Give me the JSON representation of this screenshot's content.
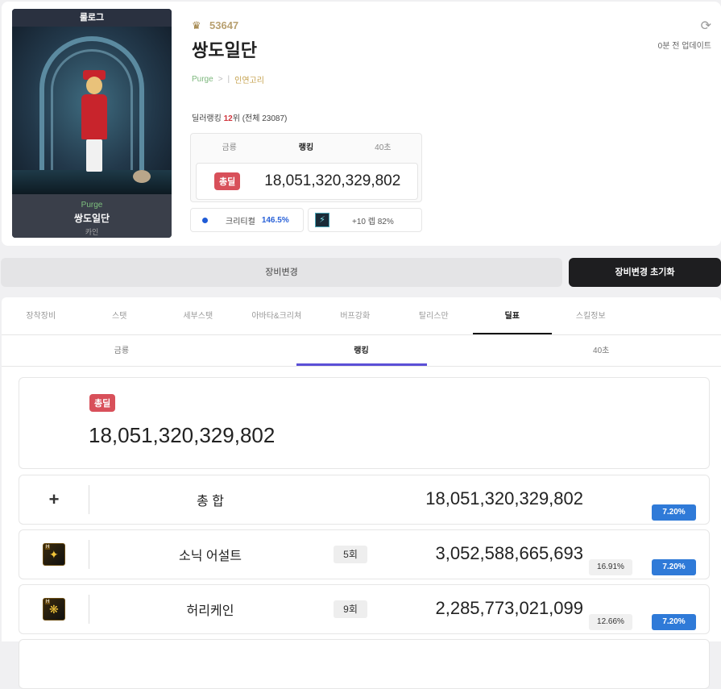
{
  "character": {
    "panel_header": "룰로그",
    "class_label": "Purge",
    "name": "쌍도일단",
    "sub": "카인",
    "fame": "53647",
    "title": "쌍도일단",
    "class_tag": "Purge",
    "class_tag_arrow": ">",
    "guild_tag": "인연고리",
    "rank_prefix": "딜러랭킹",
    "rank_num": "12",
    "rank_suffix": "위 (전체 23087)",
    "update_text": "0분 전 업데이트"
  },
  "mini": {
    "tabs": [
      "금룡",
      "랭킹",
      "40초"
    ],
    "active_tab": 1,
    "badge": "총딜",
    "value": "18,051,320,329,802",
    "crit_label": "크리티컬",
    "crit_value": "146.5%",
    "enh_label": "+10 렙 82%"
  },
  "buttons": {
    "change": "장비변경",
    "reset": "장비변경 초기화"
  },
  "tabs": [
    "장착장비",
    "스탯",
    "세부스탯",
    "아바타&크리쳐",
    "버프강화",
    "탈리스만",
    "딜표",
    "스킬정보"
  ],
  "active_tab": 6,
  "subtabs": [
    "금룡",
    "랭킹",
    "40초"
  ],
  "active_subtab": 1,
  "total": {
    "badge": "총딜",
    "value": "18,051,320,329,802"
  },
  "rows": [
    {
      "name": "총 합",
      "count": "",
      "value": "18,051,320,329,802",
      "pct_share": "",
      "pct_blue": "7.20%"
    },
    {
      "name": "소닉 어설트",
      "count": "5회",
      "value": "3,052,588,665,693",
      "pct_share": "16.91%",
      "pct_blue": "7.20%"
    },
    {
      "name": "허리케인",
      "count": "9회",
      "value": "2,285,773,021,099",
      "pct_share": "12.66%",
      "pct_blue": "7.20%"
    }
  ],
  "colors": {
    "accent_red": "#d8505a",
    "accent_blue": "#2f7ad8",
    "tab_indicator": "#5b4fd6"
  }
}
